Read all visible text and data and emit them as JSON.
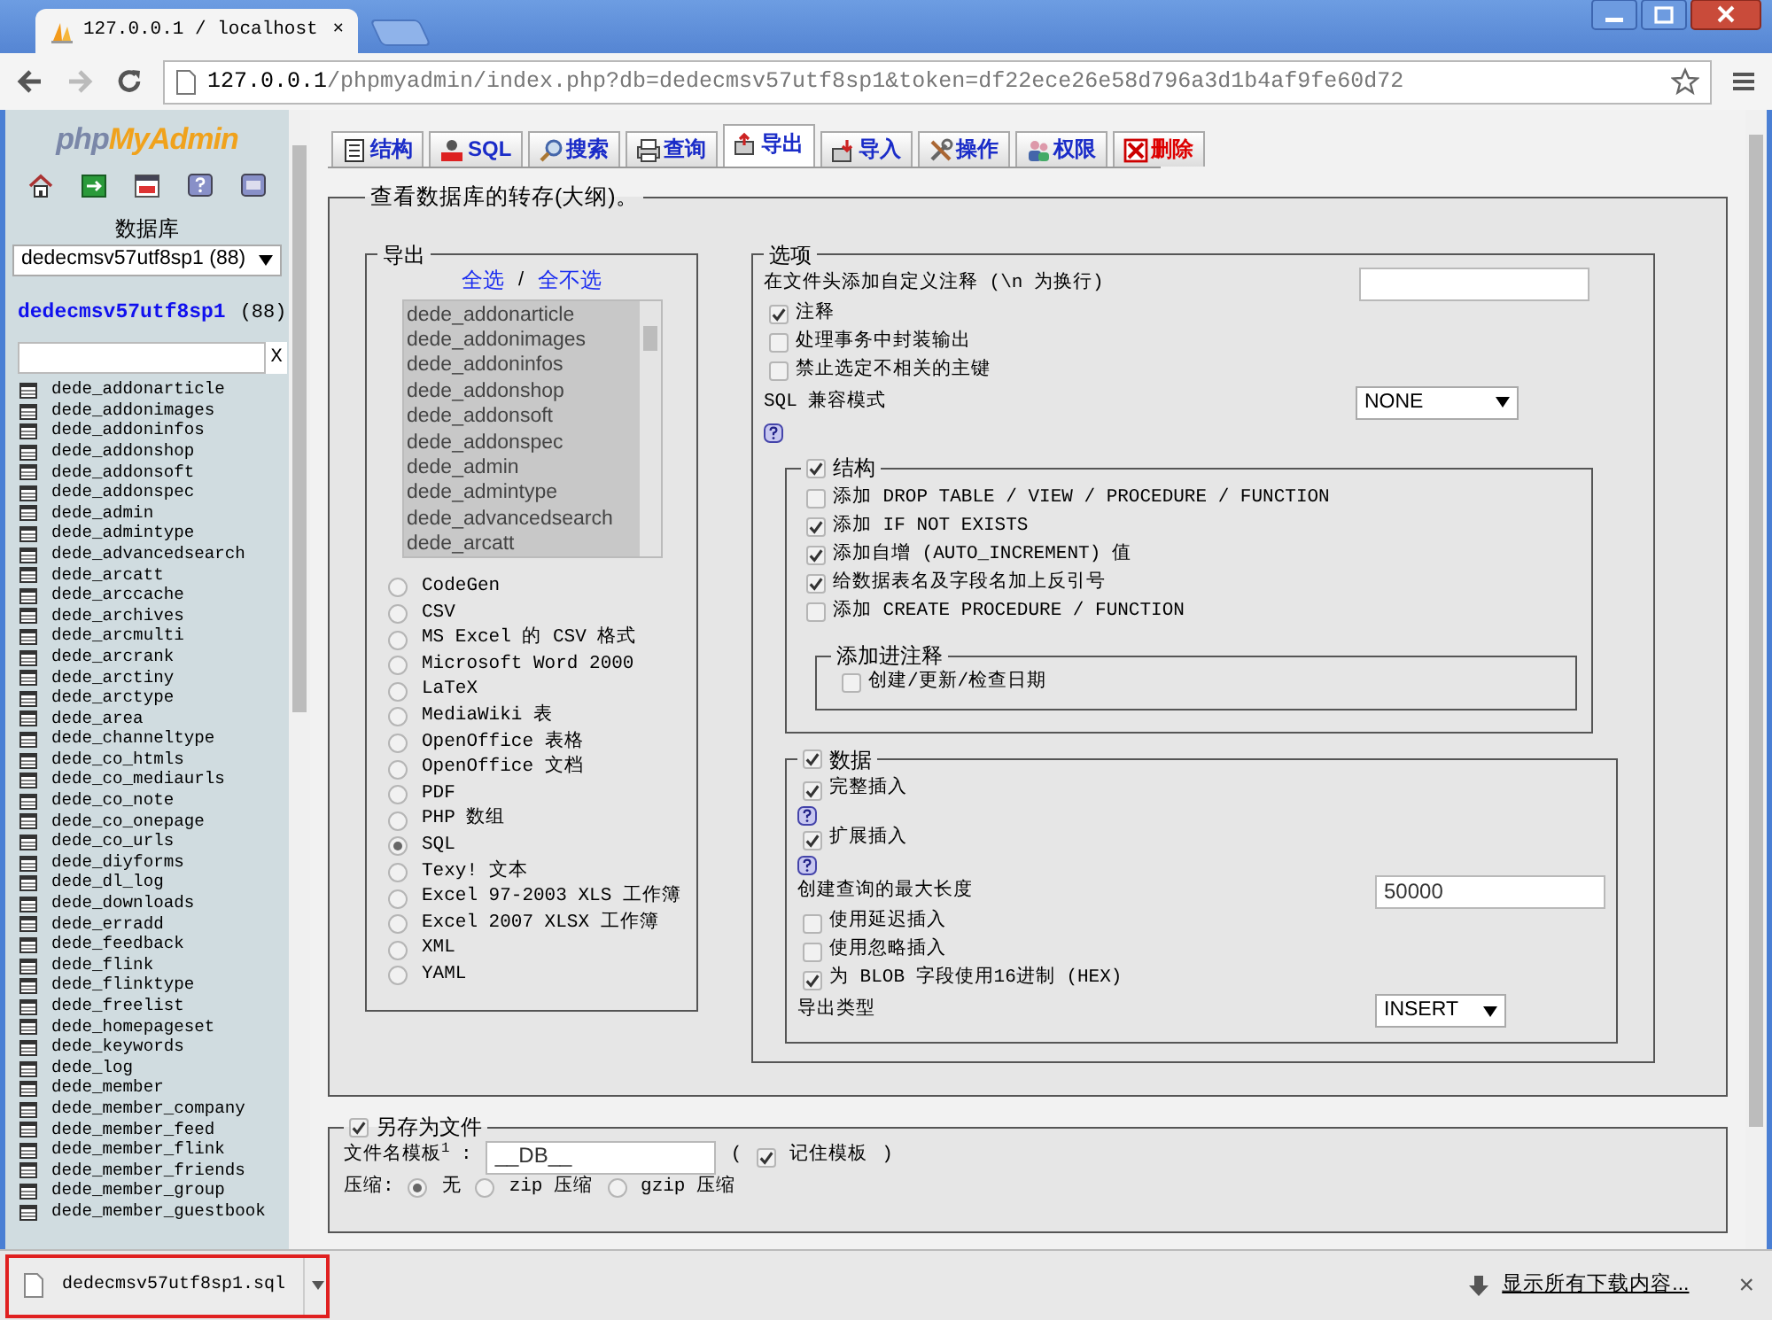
{
  "browser": {
    "tab_title": "127.0.0.1 / localhost",
    "tab_close": "×",
    "url_host": "127.0.0.1",
    "url_path": "/phpmyadmin/index.php?db=dedecmsv57utf8sp1&token=df22ece26e58d796a3d1b4af9fe60d72"
  },
  "sidebar": {
    "logo": {
      "part1": "php",
      "part2": "MyAdmin"
    },
    "db_label": "数据库",
    "db_select": "dedecmsv57utf8sp1 (88)",
    "db_name": "dedecmsv57utf8sp1",
    "db_count": "(88)",
    "filter_clear": "X",
    "tables": [
      "dede_addonarticle",
      "dede_addonimages",
      "dede_addoninfos",
      "dede_addonshop",
      "dede_addonsoft",
      "dede_addonspec",
      "dede_admin",
      "dede_admintype",
      "dede_advancedsearch",
      "dede_arcatt",
      "dede_arccache",
      "dede_archives",
      "dede_arcmulti",
      "dede_arcrank",
      "dede_arctiny",
      "dede_arctype",
      "dede_area",
      "dede_channeltype",
      "dede_co_htmls",
      "dede_co_mediaurls",
      "dede_co_note",
      "dede_co_onepage",
      "dede_co_urls",
      "dede_diyforms",
      "dede_dl_log",
      "dede_downloads",
      "dede_erradd",
      "dede_feedback",
      "dede_flink",
      "dede_flinktype",
      "dede_freelist",
      "dede_homepageset",
      "dede_keywords",
      "dede_log",
      "dede_member",
      "dede_member_company",
      "dede_member_feed",
      "dede_member_flink",
      "dede_member_friends",
      "dede_member_group",
      "dede_member_guestbook"
    ]
  },
  "tabs": [
    {
      "label": "结构",
      "kind": "structure",
      "selected": false
    },
    {
      "label": "SQL",
      "kind": "sql",
      "selected": false
    },
    {
      "label": "搜索",
      "kind": "search",
      "selected": false
    },
    {
      "label": "查询",
      "kind": "query",
      "selected": false
    },
    {
      "label": "导出",
      "kind": "export",
      "selected": true
    },
    {
      "label": "导入",
      "kind": "import",
      "selected": false
    },
    {
      "label": "操作",
      "kind": "operations",
      "selected": false
    },
    {
      "label": "权限",
      "kind": "privileges",
      "selected": false
    },
    {
      "label": "删除",
      "kind": "drop",
      "selected": false
    }
  ],
  "dump": {
    "legend": "查看数据库的转存(大纲)。",
    "export": {
      "legend": "导出",
      "select_all": "全选",
      "separator": "/",
      "select_none": "全不选",
      "tables": [
        "dede_addonarticle",
        "dede_addonimages",
        "dede_addoninfos",
        "dede_addonshop",
        "dede_addonsoft",
        "dede_addonspec",
        "dede_admin",
        "dede_admintype",
        "dede_advancedsearch",
        "dede_arcatt"
      ],
      "formats": [
        {
          "label": "CodeGen",
          "selected": false
        },
        {
          "label": "CSV",
          "selected": false
        },
        {
          "label": "MS Excel 的 CSV 格式",
          "selected": false
        },
        {
          "label": "Microsoft Word 2000",
          "selected": false
        },
        {
          "label": "LaTeX",
          "selected": false
        },
        {
          "label": "MediaWiki 表",
          "selected": false
        },
        {
          "label": "OpenOffice 表格",
          "selected": false
        },
        {
          "label": "OpenOffice 文档",
          "selected": false
        },
        {
          "label": "PDF",
          "selected": false
        },
        {
          "label": "PHP 数组",
          "selected": false
        },
        {
          "label": "SQL",
          "selected": true
        },
        {
          "label": "Texy! 文本",
          "selected": false
        },
        {
          "label": "Excel 97-2003 XLS 工作簿",
          "selected": false
        },
        {
          "label": "Excel 2007 XLSX 工作簿",
          "selected": false
        },
        {
          "label": "XML",
          "selected": false
        },
        {
          "label": "YAML",
          "selected": false
        }
      ]
    },
    "options": {
      "legend": "选项",
      "comment_label": "在文件头添加自定义注释 (\\n 为换行)",
      "checks": [
        {
          "label": "注释",
          "checked": true
        },
        {
          "label": "处理事务中封装输出",
          "checked": false
        },
        {
          "label": "禁止选定不相关的主键",
          "checked": false
        }
      ],
      "compat_label": "SQL 兼容模式",
      "compat_value": "NONE",
      "structure": {
        "legend": "结构",
        "checked": true,
        "items": [
          {
            "label": "添加 DROP TABLE / VIEW / PROCEDURE / FUNCTION",
            "checked": false
          },
          {
            "label": "添加 IF NOT EXISTS",
            "checked": true
          },
          {
            "label": "添加自增 (AUTO_INCREMENT) 值",
            "checked": true
          },
          {
            "label": "给数据表名及字段名加上反引号",
            "checked": true
          },
          {
            "label": "添加 CREATE PROCEDURE / FUNCTION",
            "checked": false
          }
        ],
        "comments": {
          "legend": "添加进注释",
          "items": [
            {
              "label": "创建/更新/检查日期",
              "checked": false
            }
          ]
        }
      },
      "data": {
        "legend": "数据",
        "checked": true,
        "items": [
          {
            "kind": "checkbox",
            "label": "完整插入",
            "checked": true,
            "help": true
          },
          {
            "kind": "checkbox",
            "label": "扩展插入",
            "checked": true,
            "help": true
          },
          {
            "kind": "input",
            "label": "创建查询的最大长度",
            "value": "50000"
          },
          {
            "kind": "checkbox",
            "label": "使用延迟插入",
            "checked": false
          },
          {
            "kind": "checkbox",
            "label": "使用忽略插入",
            "checked": false
          },
          {
            "kind": "checkbox",
            "label": "为 BLOB 字段使用16进制 (HEX)",
            "checked": true
          },
          {
            "kind": "select",
            "label": "导出类型",
            "value": "INSERT"
          }
        ]
      }
    }
  },
  "save_file": {
    "legend": "另存为文件",
    "checked": true,
    "template_label": "文件名模板$^{1}$ :",
    "template_value": "__DB__",
    "open_paren": "(",
    "remember": {
      "label": "记住模板",
      "checked": true
    },
    "close_paren": ")",
    "compression_label": "压缩:",
    "compression": [
      {
        "label": "无",
        "selected": true
      },
      {
        "label": "zip 压缩",
        "selected": false
      },
      {
        "label": "gzip 压缩",
        "selected": false
      }
    ]
  },
  "download_bar": {
    "file": "dedecmsv57utf8sp1.sql",
    "highlighted": true,
    "show_all": "显示所有下载内容...",
    "close": "×"
  }
}
